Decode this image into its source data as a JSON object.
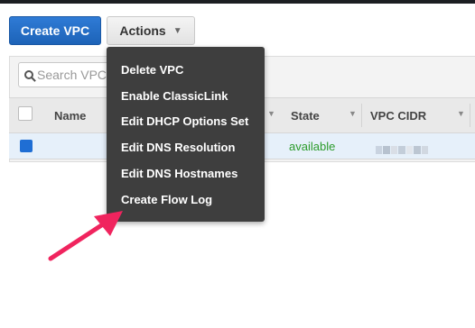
{
  "toolbar": {
    "create_label": "Create VPC",
    "actions_label": "Actions",
    "accent": "#1d63b8"
  },
  "search": {
    "placeholder": "Search VPCs"
  },
  "table": {
    "columns": [
      "Name",
      "State",
      "VPC CIDR"
    ],
    "rows": [
      {
        "name": "",
        "state": "available",
        "vpc_cidr": ""
      }
    ],
    "state_color": "#2c9c2c"
  },
  "actions_menu": {
    "items": [
      "Delete VPC",
      "Enable ClassicLink",
      "Edit DHCP Options Set",
      "Edit DNS Resolution",
      "Edit DNS Hostnames",
      "Create Flow Log"
    ],
    "background": "#3e3e3e"
  },
  "annotation": {
    "icon": "arrow-pointer-icon",
    "color": "#f0245e"
  }
}
